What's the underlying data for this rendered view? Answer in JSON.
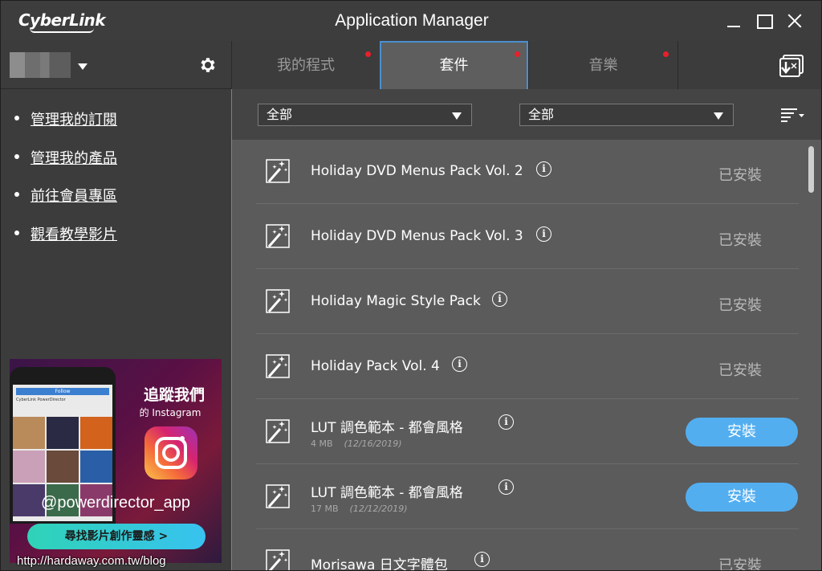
{
  "window": {
    "logo": "CyberLink",
    "title": "Application Manager"
  },
  "sidebar": {
    "menu": [
      {
        "label": "管理我的訂閱"
      },
      {
        "label": "管理我的產品"
      },
      {
        "label": "前往會員專區"
      },
      {
        "label": "觀看教學影片"
      }
    ],
    "promo": {
      "phone_follow": "Follow",
      "phone_brand": "CyberLink PowerDirector",
      "heading": "追蹤我們",
      "subheading": "的 Instagram",
      "handle": "@powerdirector_app",
      "cta": "尋找影片創作靈感 >"
    }
  },
  "tabs": [
    {
      "label": "我的程式",
      "active": false,
      "notification": true
    },
    {
      "label": "套件",
      "active": true,
      "notification": true
    },
    {
      "label": "音樂",
      "active": false,
      "notification": true
    }
  ],
  "filters": {
    "filter1": "全部",
    "filter2": "全部"
  },
  "items": [
    {
      "name": "Holiday DVD Menus Pack Vol. 2",
      "status": "已安裝"
    },
    {
      "name": "Holiday DVD Menus Pack Vol. 3",
      "status": "已安裝"
    },
    {
      "name": "Holiday Magic Style Pack",
      "status": "已安裝"
    },
    {
      "name": "Holiday Pack Vol. 4",
      "status": "已安裝"
    },
    {
      "name": "LUT 調色範本 - 都會風格",
      "size": "4 MB",
      "date": "(12/16/2019)",
      "action": "安裝"
    },
    {
      "name": "LUT 調色範本 - 都會風格",
      "size": "17 MB",
      "date": "(12/12/2019)",
      "action": "安裝"
    },
    {
      "name": "Morisawa 日文字體包",
      "status": "已安裝"
    }
  ],
  "watermark": "http://hardaway.com.tw/blog",
  "colors": {
    "accent": "#4a8fd0",
    "install_button": "#53aef0",
    "notification_dot": "#e8202a"
  }
}
